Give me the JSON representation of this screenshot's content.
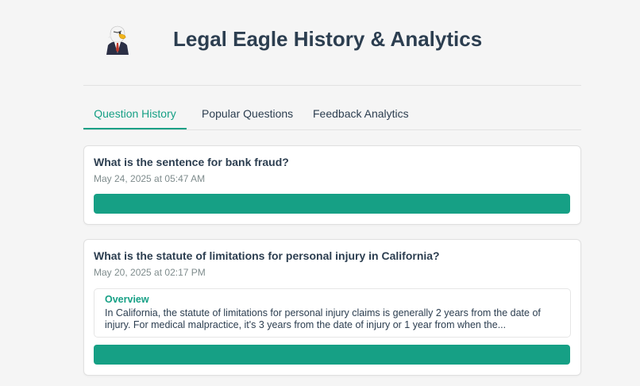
{
  "header": {
    "title": "Legal Eagle History & Analytics",
    "logo_icon": "eagle-lawyer-logo"
  },
  "tabs": [
    {
      "label": "Question History",
      "active": true
    },
    {
      "label": "Popular Questions",
      "active": false
    },
    {
      "label": "Feedback Analytics",
      "active": false
    }
  ],
  "questions": [
    {
      "title": "What is the sentence for bank fraud?",
      "date": "May 24, 2025 at 05:47 AM"
    },
    {
      "title": "What is the statute of limitations for personal injury in California?",
      "date": "May 20, 2025 at 02:17 PM",
      "overview_heading": "Overview",
      "overview_text": "In California, the statute of limitations for personal injury claims is generally 2 years from the date of injury. For medical malpractice, it's 3 years from the date of injury or 1 year from when the..."
    }
  ],
  "colors": {
    "accent": "#16a085",
    "title": "#2c3e50",
    "muted": "#7f8c8d",
    "background": "#f5f5f5"
  }
}
